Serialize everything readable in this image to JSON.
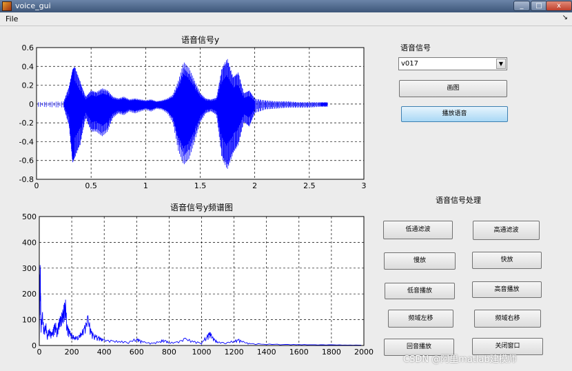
{
  "window": {
    "title": "voice_gui",
    "minimize": "_",
    "maximize": "□",
    "close": "x"
  },
  "menu": {
    "file": "File",
    "arrow": "↘"
  },
  "plot1": {
    "title": "语音信号y",
    "xticks": [
      "0",
      "0.5",
      "1",
      "1.5",
      "2",
      "2.5",
      "3"
    ],
    "yticks": [
      "0.6",
      "0.4",
      "0.2",
      "0",
      "-0.2",
      "-0.4",
      "-0.6",
      "-0.8"
    ]
  },
  "plot2": {
    "title": "语音信号y频谱图",
    "xticks": [
      "0",
      "200",
      "400",
      "600",
      "800",
      "1000",
      "1200",
      "1400",
      "1600",
      "1800",
      "2000"
    ],
    "yticks": [
      "500",
      "400",
      "300",
      "200",
      "100",
      "0"
    ]
  },
  "chart_data": [
    {
      "type": "line",
      "title": "语音信号y",
      "xlim": [
        0,
        3
      ],
      "ylim": [
        -0.8,
        0.6
      ],
      "grid": true,
      "series": [
        {
          "color": "#0000ff",
          "x": [
            0,
            0.25,
            0.3,
            0.33,
            0.35,
            0.4,
            0.45,
            0.5,
            0.55,
            0.6,
            0.65,
            0.7,
            0.75,
            0.8,
            0.85,
            0.9,
            0.95,
            1.0,
            1.05,
            1.1,
            1.15,
            1.2,
            1.25,
            1.3,
            1.35,
            1.4,
            1.45,
            1.5,
            1.55,
            1.6,
            1.65,
            1.7,
            1.75,
            1.8,
            1.85,
            1.9,
            1.95,
            2.0,
            2.1,
            2.2,
            2.3,
            2.4,
            2.5,
            2.6,
            2.67
          ],
          "ymax": [
            0.02,
            0.03,
            0.2,
            0.38,
            0.42,
            0.25,
            0.08,
            0.15,
            0.13,
            0.17,
            0.15,
            0.08,
            0.06,
            0.08,
            0.05,
            0.06,
            0.05,
            0.04,
            0.05,
            0.03,
            0.04,
            0.06,
            0.1,
            0.25,
            0.45,
            0.38,
            0.25,
            0.12,
            0.06,
            0.05,
            0.07,
            0.4,
            0.5,
            0.3,
            0.35,
            0.12,
            0.15,
            0.06,
            0.04,
            0.03,
            0.03,
            0.02,
            0.02,
            0.02,
            0.02
          ],
          "ymin": [
            -0.03,
            -0.04,
            -0.25,
            -0.65,
            -0.6,
            -0.45,
            -0.15,
            -0.3,
            -0.3,
            -0.35,
            -0.3,
            -0.15,
            -0.1,
            -0.12,
            -0.08,
            -0.1,
            -0.08,
            -0.06,
            -0.08,
            -0.05,
            -0.06,
            -0.1,
            -0.2,
            -0.5,
            -0.65,
            -0.58,
            -0.4,
            -0.2,
            -0.1,
            -0.08,
            -0.12,
            -0.6,
            -0.72,
            -0.55,
            -0.45,
            -0.2,
            -0.25,
            -0.1,
            -0.06,
            -0.05,
            -0.04,
            -0.04,
            -0.04,
            -0.03,
            -0.03
          ]
        }
      ]
    },
    {
      "type": "line",
      "title": "语音信号y频谱图",
      "xlim": [
        0,
        2000
      ],
      "ylim": [
        0,
        500
      ],
      "grid": true,
      "series": [
        {
          "color": "#0000ff",
          "x": [
            0,
            5,
            10,
            20,
            30,
            40,
            50,
            60,
            70,
            80,
            90,
            100,
            110,
            120,
            130,
            140,
            150,
            160,
            170,
            180,
            190,
            200,
            220,
            240,
            260,
            280,
            300,
            320,
            340,
            360,
            380,
            400,
            450,
            500,
            550,
            600,
            620,
            650,
            700,
            750,
            770,
            800,
            850,
            900,
            950,
            1000,
            1030,
            1050,
            1060,
            1080,
            1100,
            1150,
            1200,
            1230,
            1260,
            1300,
            1400,
            1500,
            1600,
            1700,
            1800,
            1900,
            2000
          ],
          "y": [
            0,
            420,
            90,
            130,
            60,
            95,
            40,
            70,
            55,
            50,
            80,
            95,
            60,
            100,
            115,
            130,
            150,
            205,
            90,
            70,
            55,
            45,
            35,
            40,
            55,
            80,
            120,
            60,
            45,
            40,
            30,
            25,
            20,
            18,
            15,
            30,
            22,
            14,
            10,
            20,
            25,
            12,
            15,
            30,
            18,
            12,
            40,
            55,
            45,
            25,
            15,
            12,
            20,
            25,
            15,
            8,
            6,
            5,
            4,
            3,
            3,
            2,
            2
          ]
        }
      ]
    }
  ],
  "panel_top": {
    "label": "语音信号",
    "select_value": "v017",
    "plot_button": "画图",
    "play_button": "播放语音"
  },
  "panel_bottom": {
    "label": "语音信号处理",
    "buttons": [
      "低通滤波",
      "高通滤波",
      "慢放",
      "快放",
      "低音播放",
      "高音播放",
      "频域左移",
      "频域右移",
      "回音播放",
      "关闭窗口"
    ]
  },
  "watermark": "CSDN @阿里matlab建模师"
}
